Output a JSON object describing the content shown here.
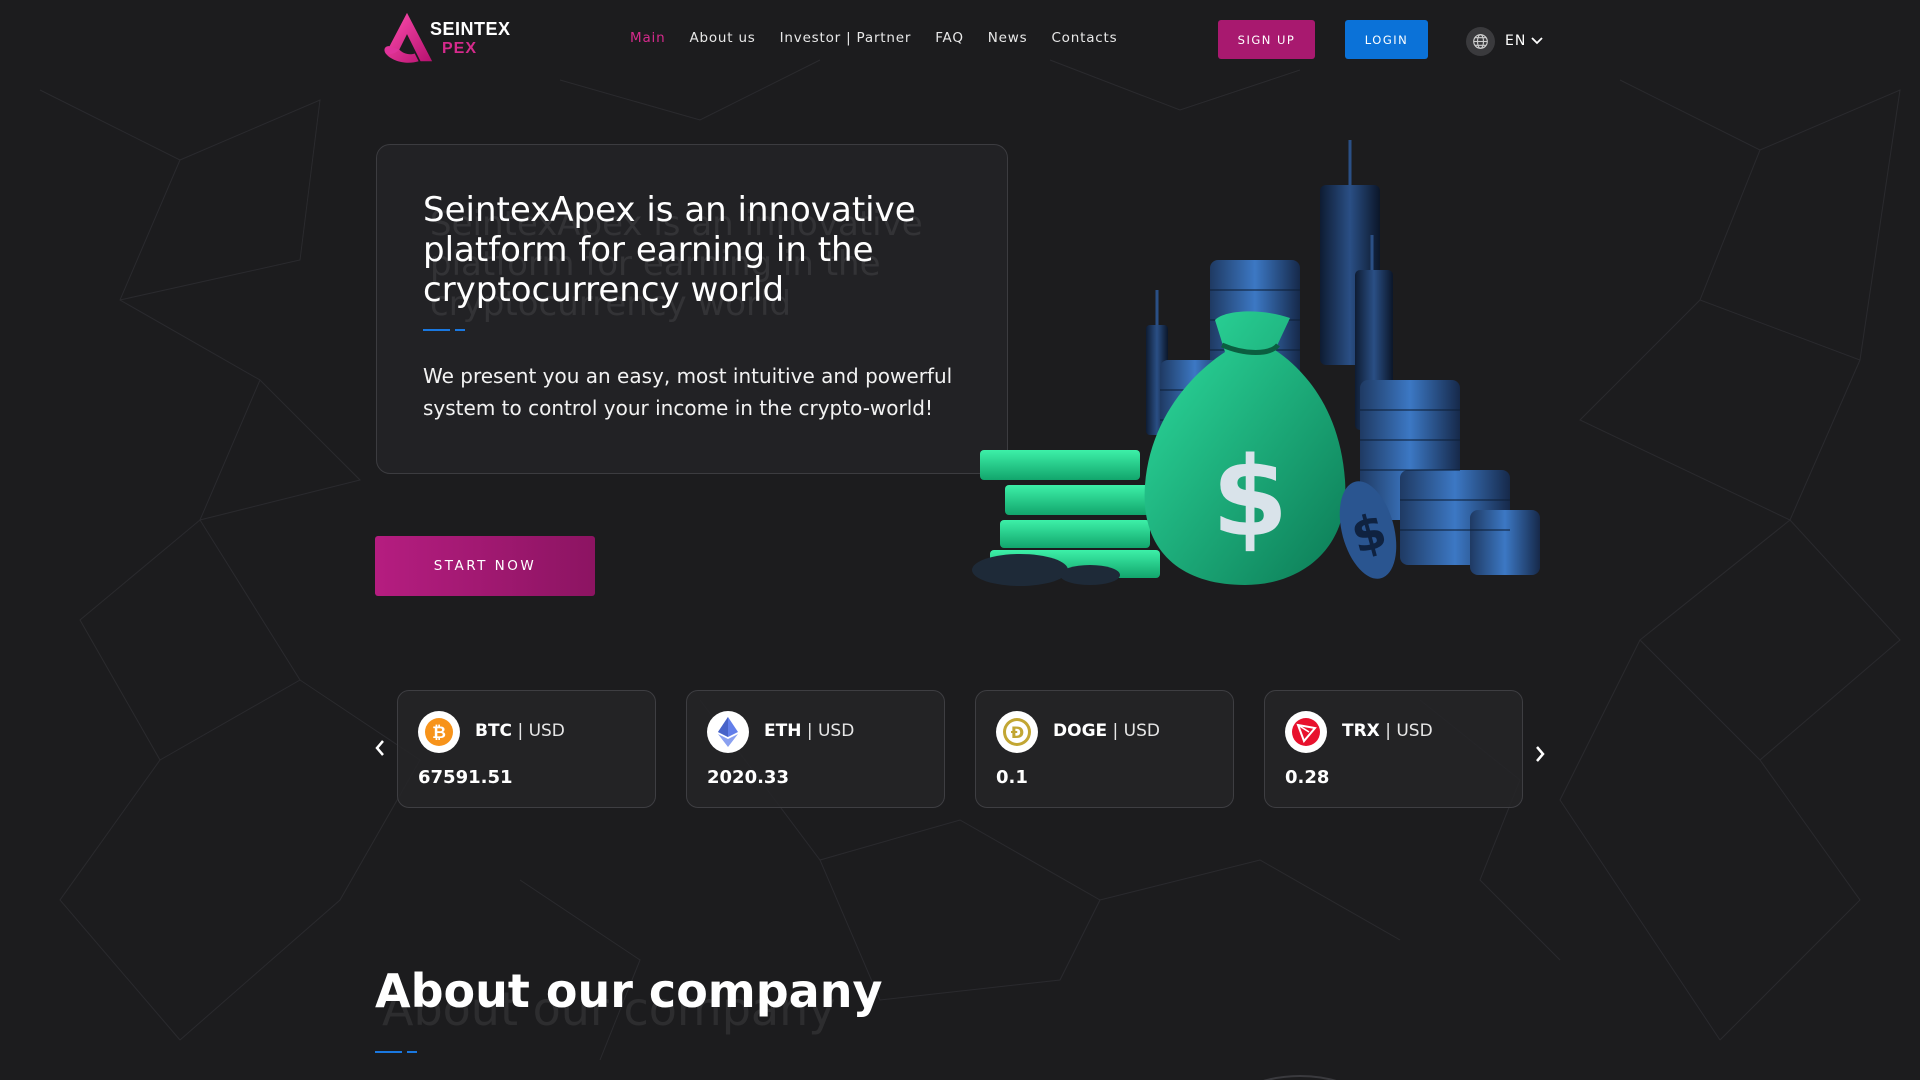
{
  "header": {
    "logo_line1": "SEINTEX",
    "logo_line2": "PEX",
    "nav": [
      {
        "label": "Main",
        "active": true
      },
      {
        "label": "About us",
        "active": false
      },
      {
        "label": "Investor | Partner",
        "active": false
      },
      {
        "label": "FAQ",
        "active": false
      },
      {
        "label": "News",
        "active": false
      },
      {
        "label": "Contacts",
        "active": false
      }
    ],
    "signup_label": "SIGN UP",
    "login_label": "LOGIN",
    "language": "EN",
    "language_icon": "globe-icon"
  },
  "hero": {
    "title": "SeintexApex is an innovative platform for earning in the cryptocurrency world",
    "subtitle": "We present you an easy, most intuitive and powerful system to control your income in the crypto-world!",
    "cta_label": "START NOW"
  },
  "tickers": [
    {
      "symbol": "BTC",
      "quote": "| USD",
      "price": "67591.51",
      "icon": "bitcoin-icon",
      "color": "#f7931a"
    },
    {
      "symbol": "ETH",
      "quote": "| USD",
      "price": "2020.33",
      "icon": "ethereum-icon",
      "color": "#627eea"
    },
    {
      "symbol": "DOGE",
      "quote": "| USD",
      "price": "0.1",
      "icon": "dogecoin-icon",
      "color": "#c2a633"
    },
    {
      "symbol": "TRX",
      "quote": "| USD",
      "price": "0.28",
      "icon": "tron-icon",
      "color": "#e8112d"
    }
  ],
  "about": {
    "title": "About our company"
  },
  "colors": {
    "background": "#1c1c1e",
    "accent_pink": "#d52a8c",
    "accent_blue": "#0b72d8",
    "cta": "#a8196f"
  }
}
